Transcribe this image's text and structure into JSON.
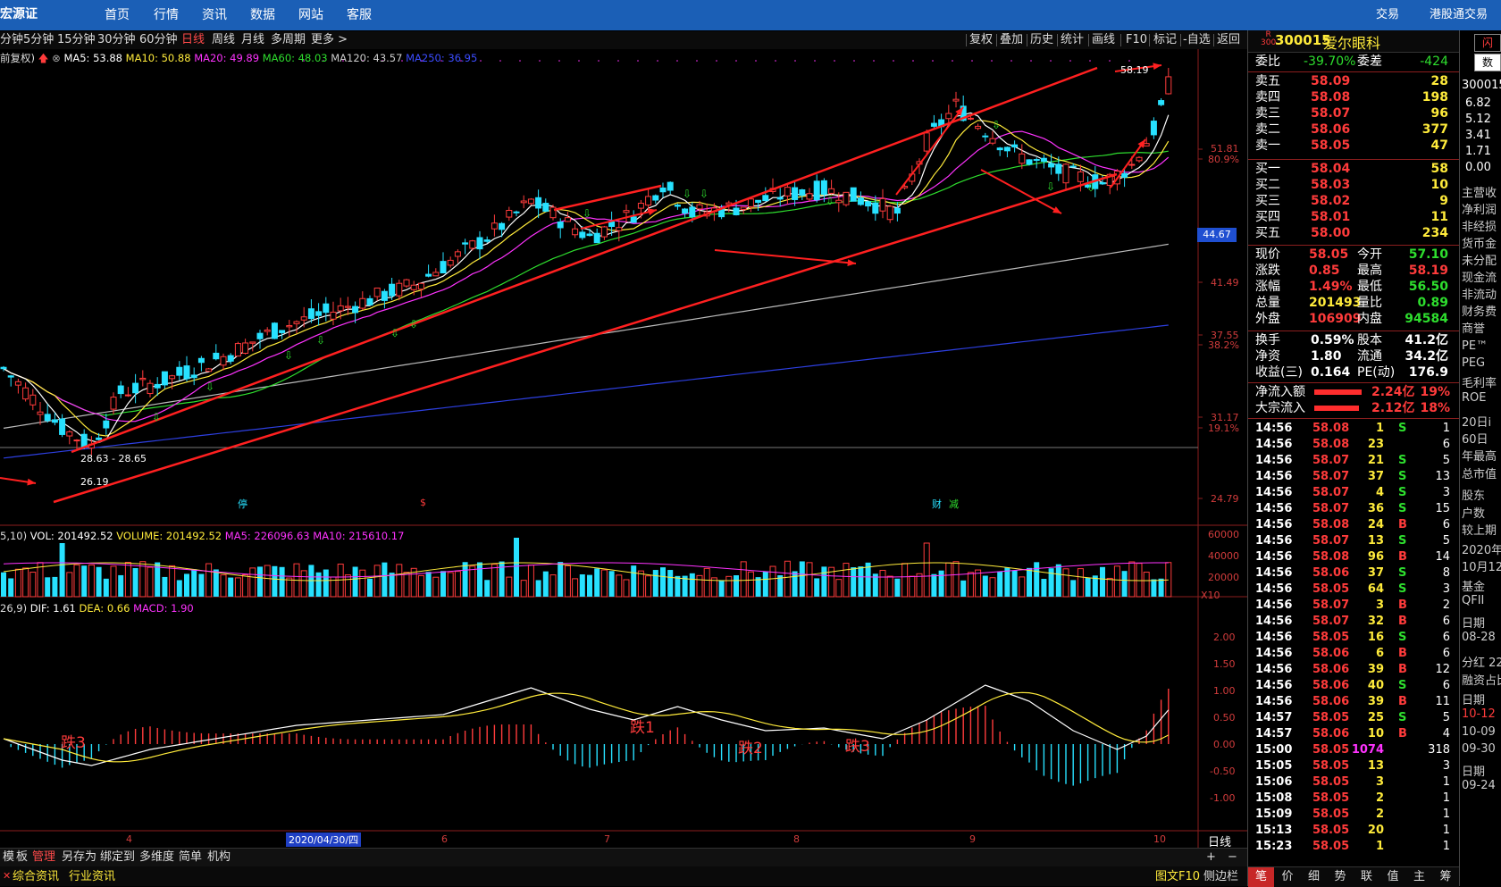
{
  "topbar": {
    "logo": "宏源证券",
    "nav": [
      "首页",
      "行情",
      "资讯",
      "数据",
      "网站",
      "客服"
    ],
    "right": [
      "交易",
      "港股通交易"
    ]
  },
  "periods": [
    "分钟",
    "5分钟",
    "15分钟",
    "30分钟",
    "60分钟",
    "日线",
    "周线",
    "月线",
    "多周期",
    "更多 >"
  ],
  "active_period": "日线",
  "toolbar": [
    "复权",
    "叠加",
    "历史",
    "统计",
    "画线",
    "F10",
    "标记",
    "-自选",
    "返回"
  ],
  "ma_legend": {
    "prefix": "前复权)",
    "items": [
      {
        "text": "MA5: 53.88",
        "color": "#ffffff"
      },
      {
        "text": "MA10: 50.88",
        "color": "#ffeb3b"
      },
      {
        "text": "MA20: 49.89",
        "color": "#ff33ff"
      },
      {
        "text": "MA60: 48.03",
        "color": "#2ede2e"
      },
      {
        "text": "MA120: 43.57",
        "color": "#cccccc"
      },
      {
        "text": "MA250: 36.95",
        "color": "#3b4cff"
      }
    ]
  },
  "price_axis": {
    "labels": [
      "51.81",
      "80.9%",
      "44.67",
      "41.49",
      "37.55",
      "38.2%",
      "31.17",
      "19.1%",
      "24.79"
    ],
    "current": "44.67"
  },
  "chart_annotations": {
    "high_label": "58.19",
    "low_label": "26.19",
    "range_label": "28.63 - 28.65",
    "macd_labels": [
      "跌3",
      "跌1",
      "跌2",
      "跌3"
    ],
    "event_markers": [
      "停",
      "$",
      "财",
      "减"
    ]
  },
  "vol_legend": {
    "prefix": "5,10)",
    "items": [
      {
        "text": "VOL: 201492.52",
        "color": "#ffffff"
      },
      {
        "text": "VOLUME: 201492.52",
        "color": "#ffeb3b"
      },
      {
        "text": "MA5: 226096.63",
        "color": "#ff33ff"
      },
      {
        "text": "MA10: 215610.17",
        "color": "#ff33ff"
      }
    ]
  },
  "vol_axis": [
    "60000",
    "40000",
    "20000",
    "X10"
  ],
  "macd_legend": {
    "prefix": "26,9)",
    "items": [
      {
        "text": "DIF: 1.61",
        "color": "#ffffff"
      },
      {
        "text": "DEA: 0.66",
        "color": "#ffeb3b"
      },
      {
        "text": "MACD: 1.90",
        "color": "#ff33ff"
      }
    ]
  },
  "macd_axis": [
    "2.00",
    "1.50",
    "1.00",
    "0.50",
    "0.00",
    "-0.50",
    "-1.00"
  ],
  "date_axis": {
    "labels": [
      "4",
      "2020/04/30/四",
      "6",
      "7",
      "8",
      "9",
      "10"
    ],
    "period_label": "日线"
  },
  "bottom_tabs": [
    "模",
    "板",
    "管理",
    "另存为",
    "绑定到",
    "多维度",
    "简单",
    "机构"
  ],
  "bottom_active": "管理",
  "status_tabs": [
    "综合资讯",
    "行业资讯"
  ],
  "status_right": [
    "图文F10",
    "侧边栏"
  ],
  "stock": {
    "code": "300015",
    "name": "爱尔眼科",
    "tag_top": "R",
    "tag_bottom": "300"
  },
  "commission": {
    "label1": "委比",
    "value1": "-39.70%",
    "label2": "委差",
    "value2": "-424"
  },
  "sell": [
    {
      "label": "卖五",
      "price": "58.09",
      "vol": "28"
    },
    {
      "label": "卖四",
      "price": "58.08",
      "vol": "198"
    },
    {
      "label": "卖三",
      "price": "58.07",
      "vol": "96"
    },
    {
      "label": "卖二",
      "price": "58.06",
      "vol": "377"
    },
    {
      "label": "卖一",
      "price": "58.05",
      "vol": "47"
    }
  ],
  "buy": [
    {
      "label": "买一",
      "price": "58.04",
      "vol": "58"
    },
    {
      "label": "买二",
      "price": "58.03",
      "vol": "10"
    },
    {
      "label": "买三",
      "price": "58.02",
      "vol": "9"
    },
    {
      "label": "买四",
      "price": "58.01",
      "vol": "11"
    },
    {
      "label": "买五",
      "price": "58.00",
      "vol": "234"
    }
  ],
  "quote": [
    {
      "l1": "现价",
      "v1": "58.05",
      "c1": "red",
      "l2": "今开",
      "v2": "57.10",
      "c2": "green"
    },
    {
      "l1": "涨跌",
      "v1": "0.85",
      "c1": "red",
      "l2": "最高",
      "v2": "58.19",
      "c2": "red"
    },
    {
      "l1": "涨幅",
      "v1": "1.49%",
      "c1": "red",
      "l2": "最低",
      "v2": "56.50",
      "c2": "green"
    },
    {
      "l1": "总量",
      "v1": "201493",
      "c1": "yellow",
      "l2": "量比",
      "v2": "0.89",
      "c2": "green"
    },
    {
      "l1": "外盘",
      "v1": "106909",
      "c1": "red",
      "l2": "内盘",
      "v2": "94584",
      "c2": "green"
    }
  ],
  "quote2": [
    {
      "l1": "换手",
      "v1": "0.59%",
      "l2": "股本",
      "v2": "41.2亿"
    },
    {
      "l1": "净资",
      "v1": "1.80",
      "l2": "流通",
      "v2": "34.2亿"
    },
    {
      "l1": "收益(三)",
      "v1": "0.164",
      "l2": "PE(动)",
      "v2": "176.9"
    }
  ],
  "flows": [
    {
      "label": "净流入额",
      "value": "2.24亿",
      "pct": "19%",
      "bar": 0.95
    },
    {
      "label": "大宗流入",
      "value": "2.12亿",
      "pct": "18%",
      "bar": 0.9
    }
  ],
  "ticks": [
    {
      "t": "14:56",
      "p": "58.08",
      "pc": "red",
      "v": "1",
      "vc": "yellow",
      "bs": "S",
      "n": "1"
    },
    {
      "t": "14:56",
      "p": "58.08",
      "pc": "red",
      "v": "23",
      "vc": "yellow",
      "bs": "",
      "n": "6"
    },
    {
      "t": "14:56",
      "p": "58.07",
      "pc": "red",
      "v": "21",
      "vc": "yellow",
      "bs": "S",
      "n": "5"
    },
    {
      "t": "14:56",
      "p": "58.07",
      "pc": "red",
      "v": "37",
      "vc": "yellow",
      "bs": "S",
      "n": "13"
    },
    {
      "t": "14:56",
      "p": "58.07",
      "pc": "red",
      "v": "4",
      "vc": "yellow",
      "bs": "S",
      "n": "3"
    },
    {
      "t": "14:56",
      "p": "58.07",
      "pc": "red",
      "v": "36",
      "vc": "yellow",
      "bs": "S",
      "n": "15"
    },
    {
      "t": "14:56",
      "p": "58.08",
      "pc": "red",
      "v": "24",
      "vc": "yellow",
      "bs": "B",
      "n": "6"
    },
    {
      "t": "14:56",
      "p": "58.07",
      "pc": "red",
      "v": "13",
      "vc": "yellow",
      "bs": "S",
      "n": "5"
    },
    {
      "t": "14:56",
      "p": "58.08",
      "pc": "red",
      "v": "96",
      "vc": "yellow",
      "bs": "B",
      "n": "14"
    },
    {
      "t": "14:56",
      "p": "58.06",
      "pc": "red",
      "v": "37",
      "vc": "yellow",
      "bs": "S",
      "n": "8"
    },
    {
      "t": "14:56",
      "p": "58.05",
      "pc": "red",
      "v": "64",
      "vc": "yellow",
      "bs": "S",
      "n": "3"
    },
    {
      "t": "14:56",
      "p": "58.07",
      "pc": "red",
      "v": "3",
      "vc": "yellow",
      "bs": "B",
      "n": "2"
    },
    {
      "t": "14:56",
      "p": "58.07",
      "pc": "red",
      "v": "32",
      "vc": "yellow",
      "bs": "B",
      "n": "6"
    },
    {
      "t": "14:56",
      "p": "58.05",
      "pc": "red",
      "v": "16",
      "vc": "yellow",
      "bs": "S",
      "n": "6"
    },
    {
      "t": "14:56",
      "p": "58.06",
      "pc": "red",
      "v": "6",
      "vc": "yellow",
      "bs": "B",
      "n": "6"
    },
    {
      "t": "14:56",
      "p": "58.06",
      "pc": "red",
      "v": "39",
      "vc": "yellow",
      "bs": "B",
      "n": "12"
    },
    {
      "t": "14:56",
      "p": "58.06",
      "pc": "red",
      "v": "40",
      "vc": "yellow",
      "bs": "S",
      "n": "6"
    },
    {
      "t": "14:56",
      "p": "58.06",
      "pc": "red",
      "v": "39",
      "vc": "yellow",
      "bs": "B",
      "n": "11"
    },
    {
      "t": "14:57",
      "p": "58.05",
      "pc": "red",
      "v": "25",
      "vc": "yellow",
      "bs": "S",
      "n": "5"
    },
    {
      "t": "14:57",
      "p": "58.06",
      "pc": "red",
      "v": "10",
      "vc": "yellow",
      "bs": "B",
      "n": "4"
    },
    {
      "t": "15:00",
      "p": "58.05",
      "pc": "red",
      "v": "1074",
      "vc": "mag",
      "bs": "",
      "n": "318"
    },
    {
      "t": "15:05",
      "p": "58.05",
      "pc": "red",
      "v": "13",
      "vc": "yellow",
      "bs": "",
      "n": "3"
    },
    {
      "t": "15:06",
      "p": "58.05",
      "pc": "red",
      "v": "3",
      "vc": "yellow",
      "bs": "",
      "n": "1"
    },
    {
      "t": "15:08",
      "p": "58.05",
      "pc": "red",
      "v": "2",
      "vc": "yellow",
      "bs": "",
      "n": "1"
    },
    {
      "t": "15:09",
      "p": "58.05",
      "pc": "red",
      "v": "2",
      "vc": "yellow",
      "bs": "",
      "n": "1"
    },
    {
      "t": "15:13",
      "p": "58.05",
      "pc": "red",
      "v": "20",
      "vc": "yellow",
      "bs": "",
      "n": "1"
    },
    {
      "t": "15:23",
      "p": "58.05",
      "pc": "red",
      "v": "1",
      "vc": "yellow",
      "bs": "",
      "n": "1"
    }
  ],
  "bottom_rtabs": [
    "笔",
    "价",
    "细",
    "势",
    "联",
    "值",
    "主",
    "筹"
  ],
  "bottom_ractive": "笔",
  "farright": {
    "top_buttons": [
      "闪",
      "数"
    ],
    "code": "300015",
    "nums": [
      "6.82",
      "5.12",
      "3.41",
      "1.71",
      "0.00"
    ],
    "items": [
      "主营收",
      "净利润",
      "非经损",
      "货币金",
      "未分配",
      "现金流",
      "非流动",
      "财务费",
      "商誉",
      "PE™",
      "PEG",
      "毛利率",
      "ROE",
      "20日i",
      "60日",
      "年最高",
      "总市值",
      "股东",
      "户数",
      "较上期",
      "2020年",
      "10月12",
      "基金",
      "QFII",
      "日期",
      "08-28",
      "分红 22",
      "融资占比",
      "日期",
      "10-12",
      "10-09",
      "09-30",
      "日期",
      "09-24"
    ]
  }
}
